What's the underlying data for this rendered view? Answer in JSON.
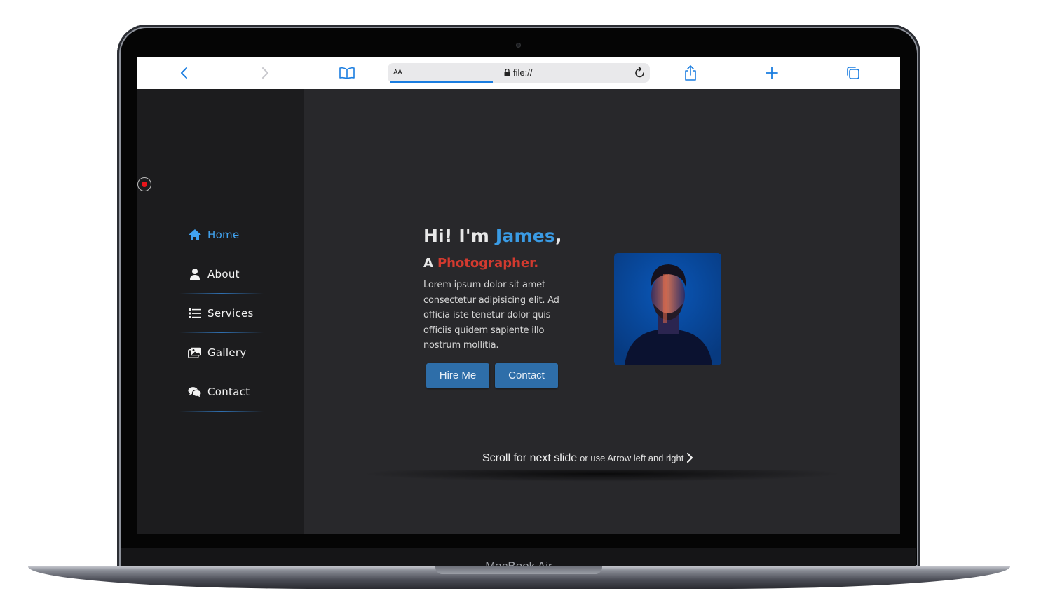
{
  "device": {
    "label": "MacBook Air"
  },
  "browser": {
    "address_aa": "AA",
    "url": "file://",
    "icons": [
      "back-icon",
      "forward-icon",
      "bookmarks-icon",
      "lock-icon",
      "reload-icon",
      "share-icon",
      "new-tab-icon",
      "tabs-icon"
    ],
    "accent": "#1a7de0"
  },
  "sidebar": {
    "items": [
      {
        "label": "Home",
        "icon": "home-icon",
        "active": true
      },
      {
        "label": "About",
        "icon": "user-icon"
      },
      {
        "label": "Services",
        "icon": "list-icon"
      },
      {
        "label": "Gallery",
        "icon": "images-icon"
      },
      {
        "label": "Contact",
        "icon": "chat-icon"
      }
    ],
    "accent": "#41a3f0"
  },
  "hero": {
    "greeting_prefix": "Hi! I'm ",
    "name": "James",
    "greeting_suffix": ",",
    "role_prefix": "A",
    "role": "Photographer.",
    "description": "Lorem ipsum dolor sit amet consectetur adipisicing elit. Ad officia iste tenetur dolor quis officiis quidem sapiente illo nostrum mollitia.",
    "buttons": {
      "hire": "Hire Me",
      "contact": "Contact"
    },
    "colors": {
      "name": "#3a9be4",
      "role": "#d23a2f",
      "button": "#2e6ea9"
    }
  },
  "footer_hint": {
    "main": "Scroll for next slide",
    "sub": "or use Arrow left and right"
  }
}
